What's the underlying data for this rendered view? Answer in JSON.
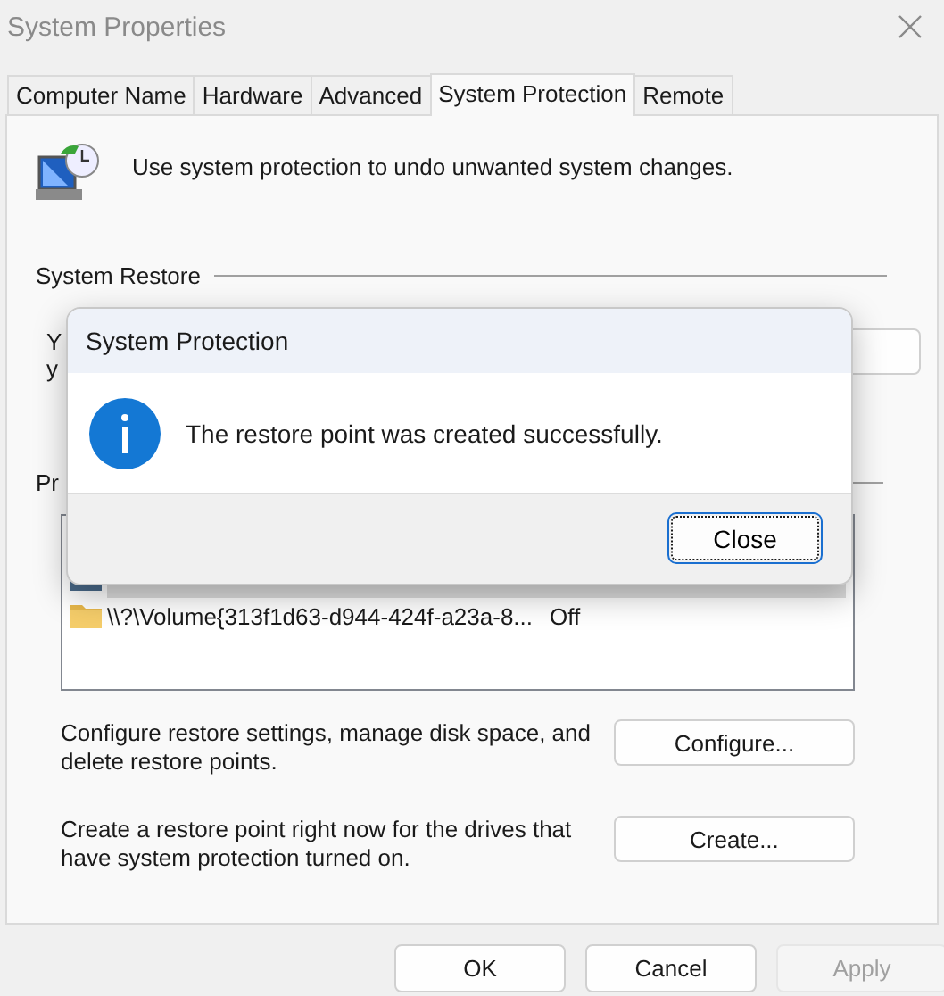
{
  "window": {
    "title": "System Properties"
  },
  "tabs": [
    {
      "label": "Computer Name",
      "selected": false
    },
    {
      "label": "Hardware",
      "selected": false
    },
    {
      "label": "Advanced",
      "selected": false
    },
    {
      "label": "System Protection",
      "selected": true
    },
    {
      "label": "Remote",
      "selected": false
    }
  ],
  "intro": "Use system protection to undo unwanted system changes.",
  "system_restore": {
    "heading": "System Restore",
    "text_lines": [
      "Y",
      "y"
    ]
  },
  "protection_settings": {
    "heading": "Pr",
    "drives": [
      {
        "kind": "disk",
        "selected": true
      },
      {
        "name": "\\\\?\\Volume{313f1d63-d944-424f-a23a-8...",
        "protection": "Off",
        "kind": "folder",
        "selected": false
      }
    ]
  },
  "actions": [
    {
      "text": "Configure restore settings, manage disk space, and delete restore points.",
      "button": "Configure..."
    },
    {
      "text": "Create a restore point right now for the drives that have system protection turned on.",
      "button": "Create..."
    }
  ],
  "buttons": [
    {
      "label": "OK",
      "disabled": false
    },
    {
      "label": "Cancel",
      "disabled": false
    },
    {
      "label": "Apply",
      "disabled": true
    }
  ],
  "dialog": {
    "title": "System Protection",
    "message": "The restore point was created successfully.",
    "button": "Close"
  }
}
